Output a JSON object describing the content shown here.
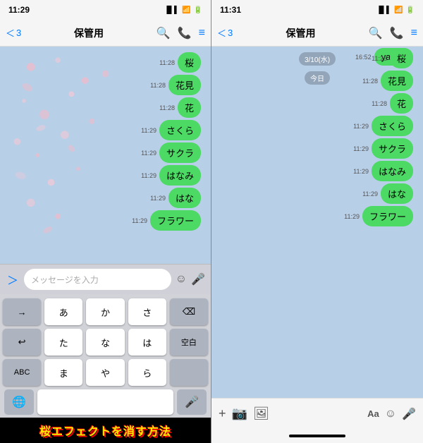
{
  "left_screen": {
    "status_time": "11:29",
    "nav_back_num": "3",
    "nav_title": "保管用",
    "messages": [
      {
        "time": "11:28",
        "text": "桜"
      },
      {
        "time": "11:28",
        "text": "花見"
      },
      {
        "time": "11:28",
        "text": "花"
      },
      {
        "time": "11:29",
        "text": "さくら"
      },
      {
        "time": "11:29",
        "text": "サクラ"
      },
      {
        "time": "11:29",
        "text": "はなみ"
      },
      {
        "time": "11:29",
        "text": "はな"
      },
      {
        "time": "11:29",
        "text": "フラワー"
      }
    ],
    "input_placeholder": "メッセージを入力",
    "keyboard": {
      "row1": [
        "あ",
        "か",
        "さ"
      ],
      "row2": [
        "た",
        "な",
        "は"
      ],
      "row3": [
        "ま",
        "や",
        "ら"
      ],
      "abc_label": "ABC",
      "delete_label": "⌫",
      "space_label": "空白",
      "arrow_label": "→",
      "undo_label": "↩"
    }
  },
  "right_screen": {
    "status_time": "11:31",
    "nav_back_num": "3",
    "nav_title": "保管用",
    "date_label": "3/10(水)",
    "today_label": "今日",
    "messages_top": [
      {
        "time": "16:52",
        "text": "yahoo"
      }
    ],
    "messages_main": [
      {
        "time": "11:28",
        "text": "桜"
      },
      {
        "time": "11:28",
        "text": "花見"
      },
      {
        "time": "11:28",
        "text": "花"
      },
      {
        "time": "11:29",
        "text": "さくら"
      },
      {
        "time": "11:29",
        "text": "サクラ"
      },
      {
        "time": "11:29",
        "text": "はなみ"
      },
      {
        "time": "11:29",
        "text": "はな"
      },
      {
        "time": "11:29",
        "text": "フラワー"
      }
    ]
  },
  "bottom_label": "桜エフェクトを消す方法",
  "icons": {
    "search": "🔍",
    "phone": "📞",
    "menu": "≡",
    "chevron": "＜",
    "emoji": "☺",
    "mic": "🎤",
    "camera": "📷",
    "image": "🖼",
    "globe": "🌐",
    "plus": "+",
    "back_arrow": "＜"
  }
}
